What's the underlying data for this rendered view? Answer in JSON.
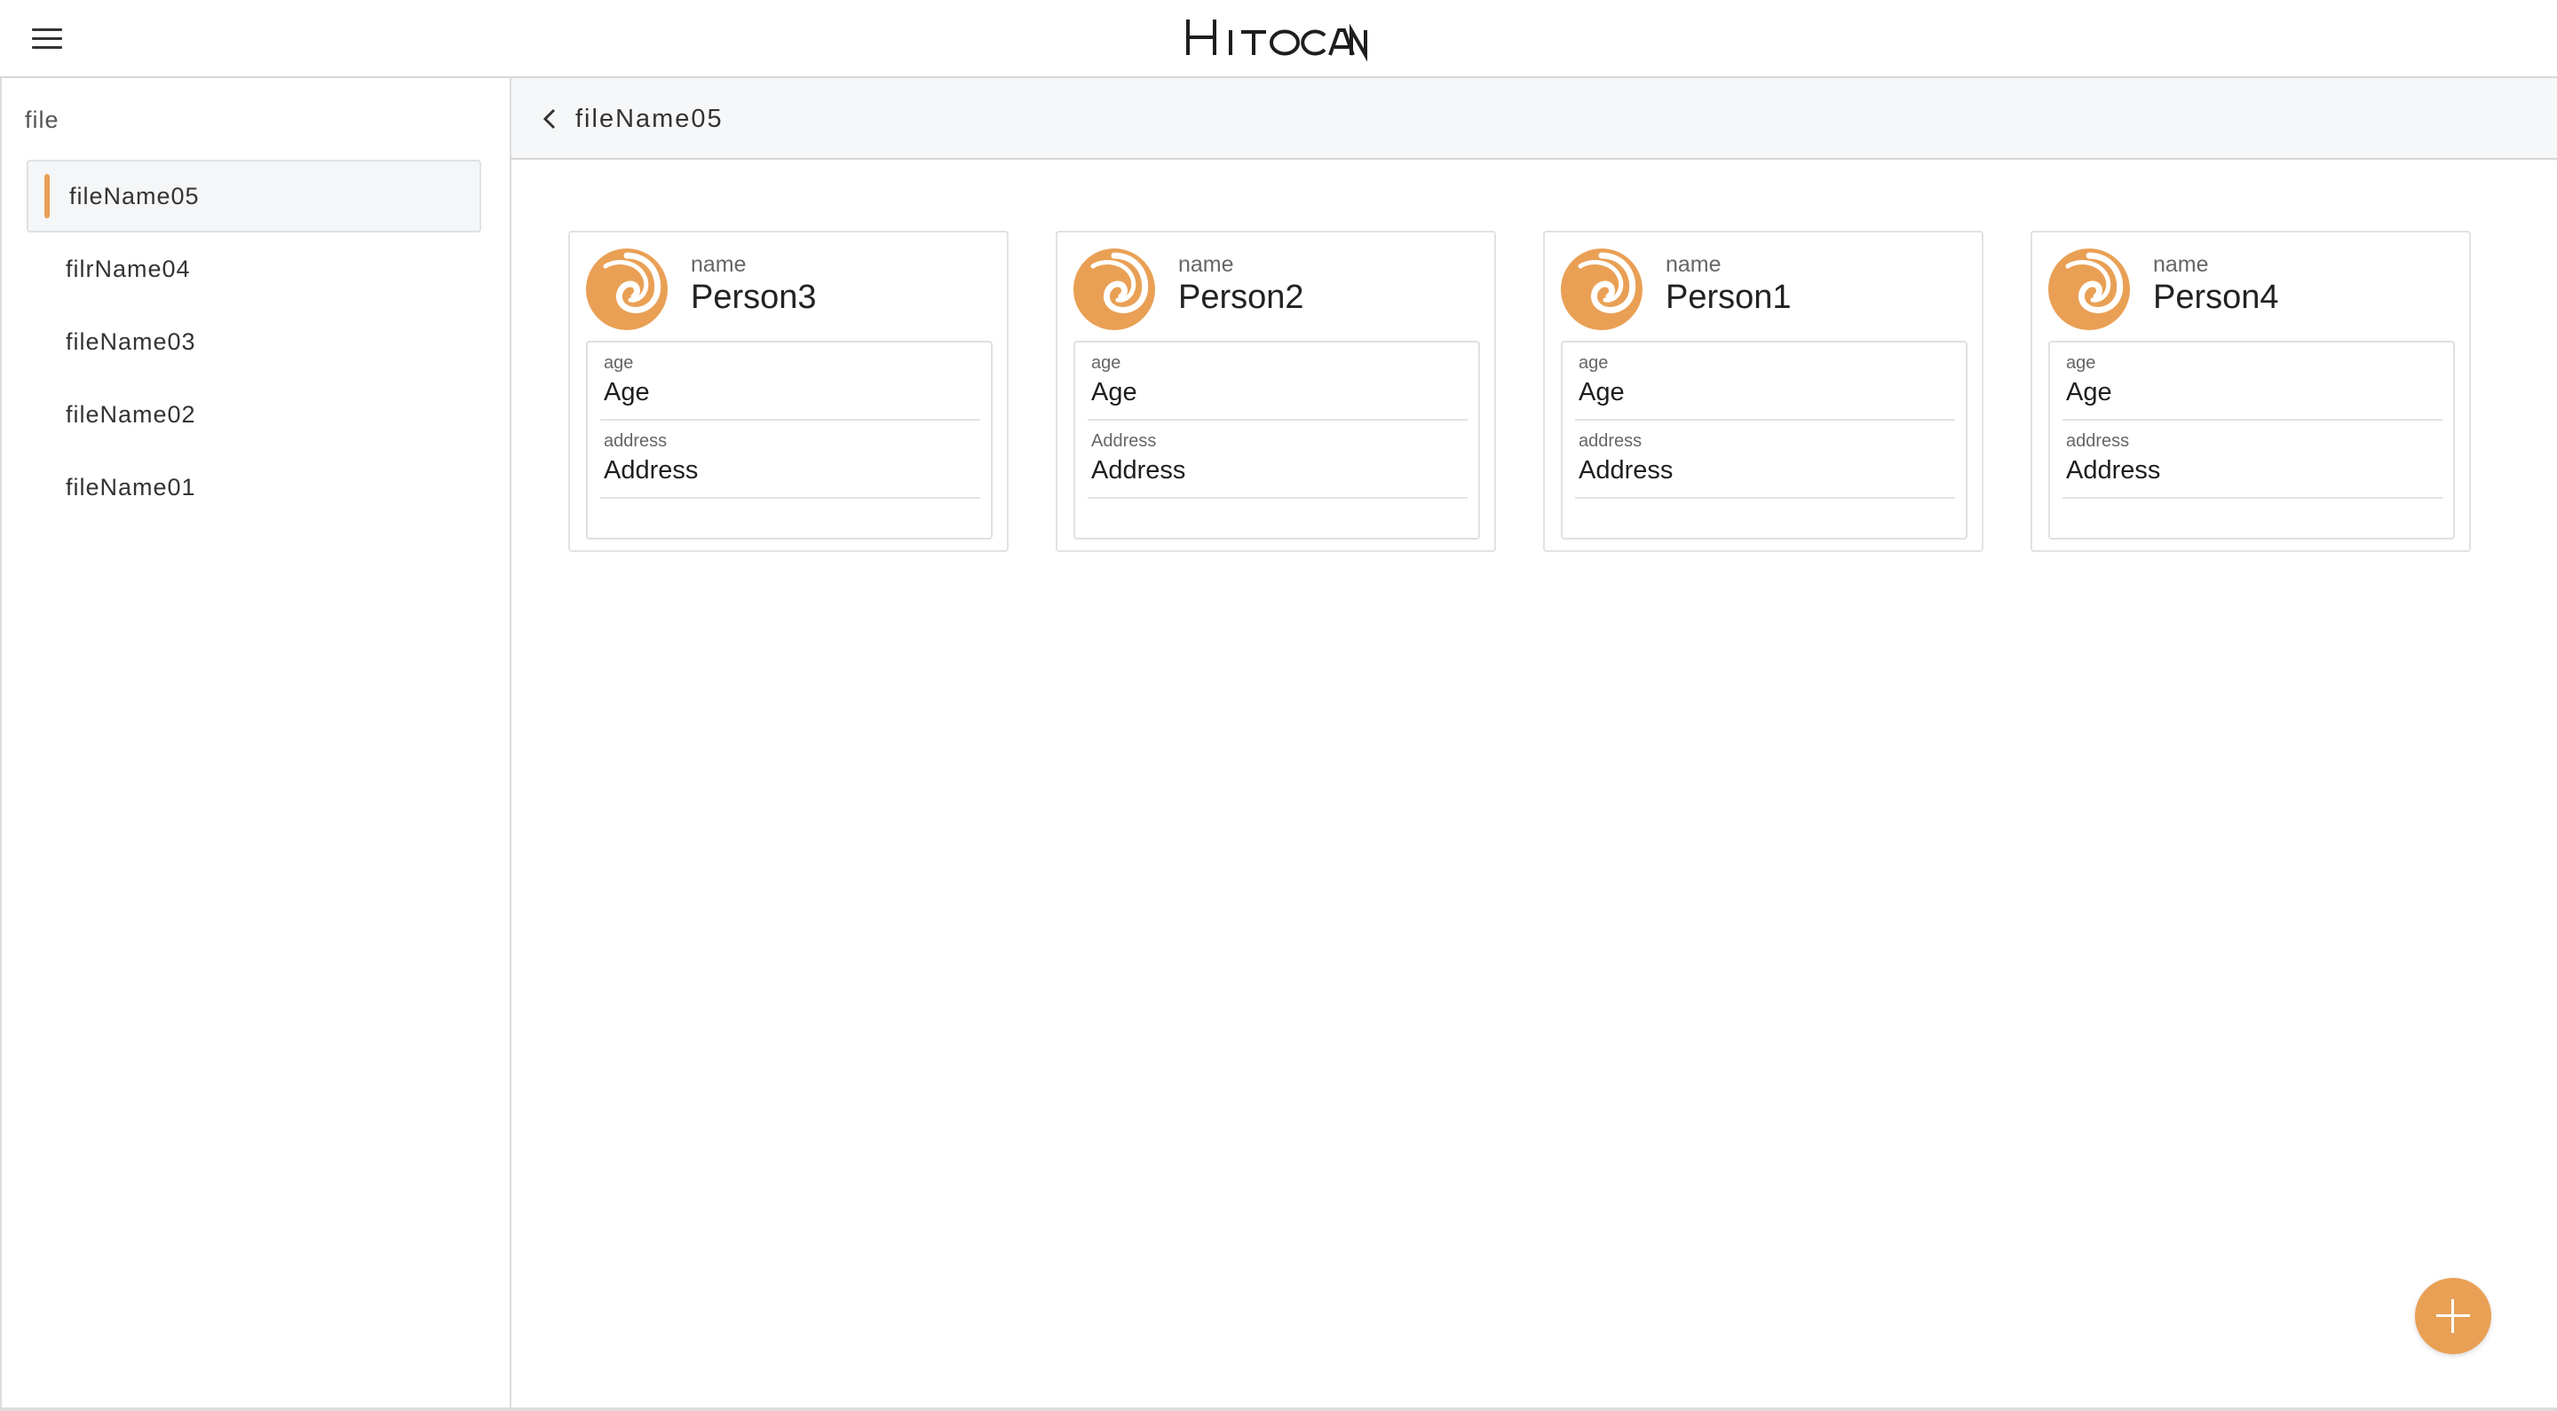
{
  "header": {
    "logo": "Hitocan",
    "menu_icon": "hamburger-menu-icon"
  },
  "sidebar": {
    "title": "file",
    "items": [
      {
        "label": "fileName05",
        "active": true
      },
      {
        "label": "filrName04",
        "active": false
      },
      {
        "label": "fileName03",
        "active": false
      },
      {
        "label": "fileName02",
        "active": false
      },
      {
        "label": "fileName01",
        "active": false
      }
    ]
  },
  "main": {
    "back_icon": "chevron-left-icon",
    "title": "fileName05",
    "cards": [
      {
        "name_label": "name",
        "name": "Person3",
        "age_label": "age",
        "age": "Age",
        "address_label": "address",
        "address": "Address"
      },
      {
        "name_label": "name",
        "name": "Person2",
        "age_label": "age",
        "age": "Age",
        "address_label": "Address",
        "address": "Address"
      },
      {
        "name_label": "name",
        "name": "Person1",
        "age_label": "age",
        "age": "Age",
        "address_label": "address",
        "address": "Address"
      },
      {
        "name_label": "name",
        "name": "Person4",
        "age_label": "age",
        "age": "Age",
        "address_label": "address",
        "address": "Address"
      }
    ],
    "fab_icon": "plus-icon"
  },
  "colors": {
    "accent": "#e9a055",
    "subheader_bg": "#f6f7f8"
  }
}
